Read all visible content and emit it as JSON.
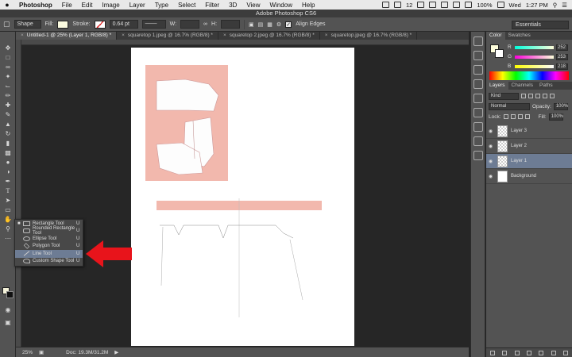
{
  "menubar": {
    "app": "Photoshop",
    "items": [
      "File",
      "Edit",
      "Image",
      "Layer",
      "Type",
      "Select",
      "Filter",
      "3D",
      "View",
      "Window",
      "Help"
    ],
    "status_num": "12",
    "battery": "100%",
    "day": "Wed",
    "time": "1:27 PM"
  },
  "window": {
    "title": "Adobe Photoshop CS6"
  },
  "options": {
    "mode": "Shape",
    "fill_label": "Fill:",
    "stroke_label": "Stroke:",
    "stroke_width": "0.64 pt",
    "w_label": "W:",
    "h_label": "H:",
    "align_edges": "Align Edges",
    "workspace": "Essentials"
  },
  "tabs": [
    {
      "label": "Untitled-1 @ 25% (Layer 1, RGB/8) *",
      "active": true
    },
    {
      "label": "squaretop 1.jpeg @ 16.7% (RGB/8) *",
      "active": false
    },
    {
      "label": "squaretop 2.jpeg @ 16.7% (RGB/8) *",
      "active": false
    },
    {
      "label": "squaretop.jpeg @ 16.7% (RGB/8) *",
      "active": false
    }
  ],
  "status": {
    "zoom": "25%",
    "doc": "Doc: 19.3M/31.2M"
  },
  "flyout": {
    "items": [
      {
        "label": "Rectangle Tool",
        "key": "U",
        "icon": "rectangle-icon"
      },
      {
        "label": "Rounded Rectangle Tool",
        "key": "U",
        "icon": "rounded-rectangle-icon"
      },
      {
        "label": "Ellipse Tool",
        "key": "U",
        "icon": "ellipse-icon"
      },
      {
        "label": "Polygon Tool",
        "key": "U",
        "icon": "polygon-icon"
      },
      {
        "label": "Line Tool",
        "key": "U",
        "icon": "line-icon"
      },
      {
        "label": "Custom Shape Tool",
        "key": "U",
        "icon": "custom-shape-icon"
      }
    ],
    "selected_index": 4
  },
  "color_panel": {
    "tabs": [
      "Color",
      "Swatches"
    ],
    "r_label": "R",
    "r": "252",
    "g_label": "G",
    "g": "253",
    "b_label": "B",
    "b": "218",
    "fg_color": "#fcfdda"
  },
  "layers_panel": {
    "tabs": [
      "Layers",
      "Channels",
      "Paths"
    ],
    "kind": "Kind",
    "blend": "Normal",
    "opacity_label": "Opacity:",
    "opacity": "100%",
    "lock_label": "Lock:",
    "fill_label": "Fill:",
    "fill": "100%",
    "layers": [
      {
        "name": "Layer 3",
        "selected": false
      },
      {
        "name": "Layer 2",
        "selected": false
      },
      {
        "name": "Layer 1",
        "selected": true
      },
      {
        "name": "Background",
        "selected": false
      }
    ]
  },
  "colors": {
    "accent_arrow": "#e8141b",
    "selection": "#6d7c94",
    "paper_pink": "#f2b8ad"
  }
}
